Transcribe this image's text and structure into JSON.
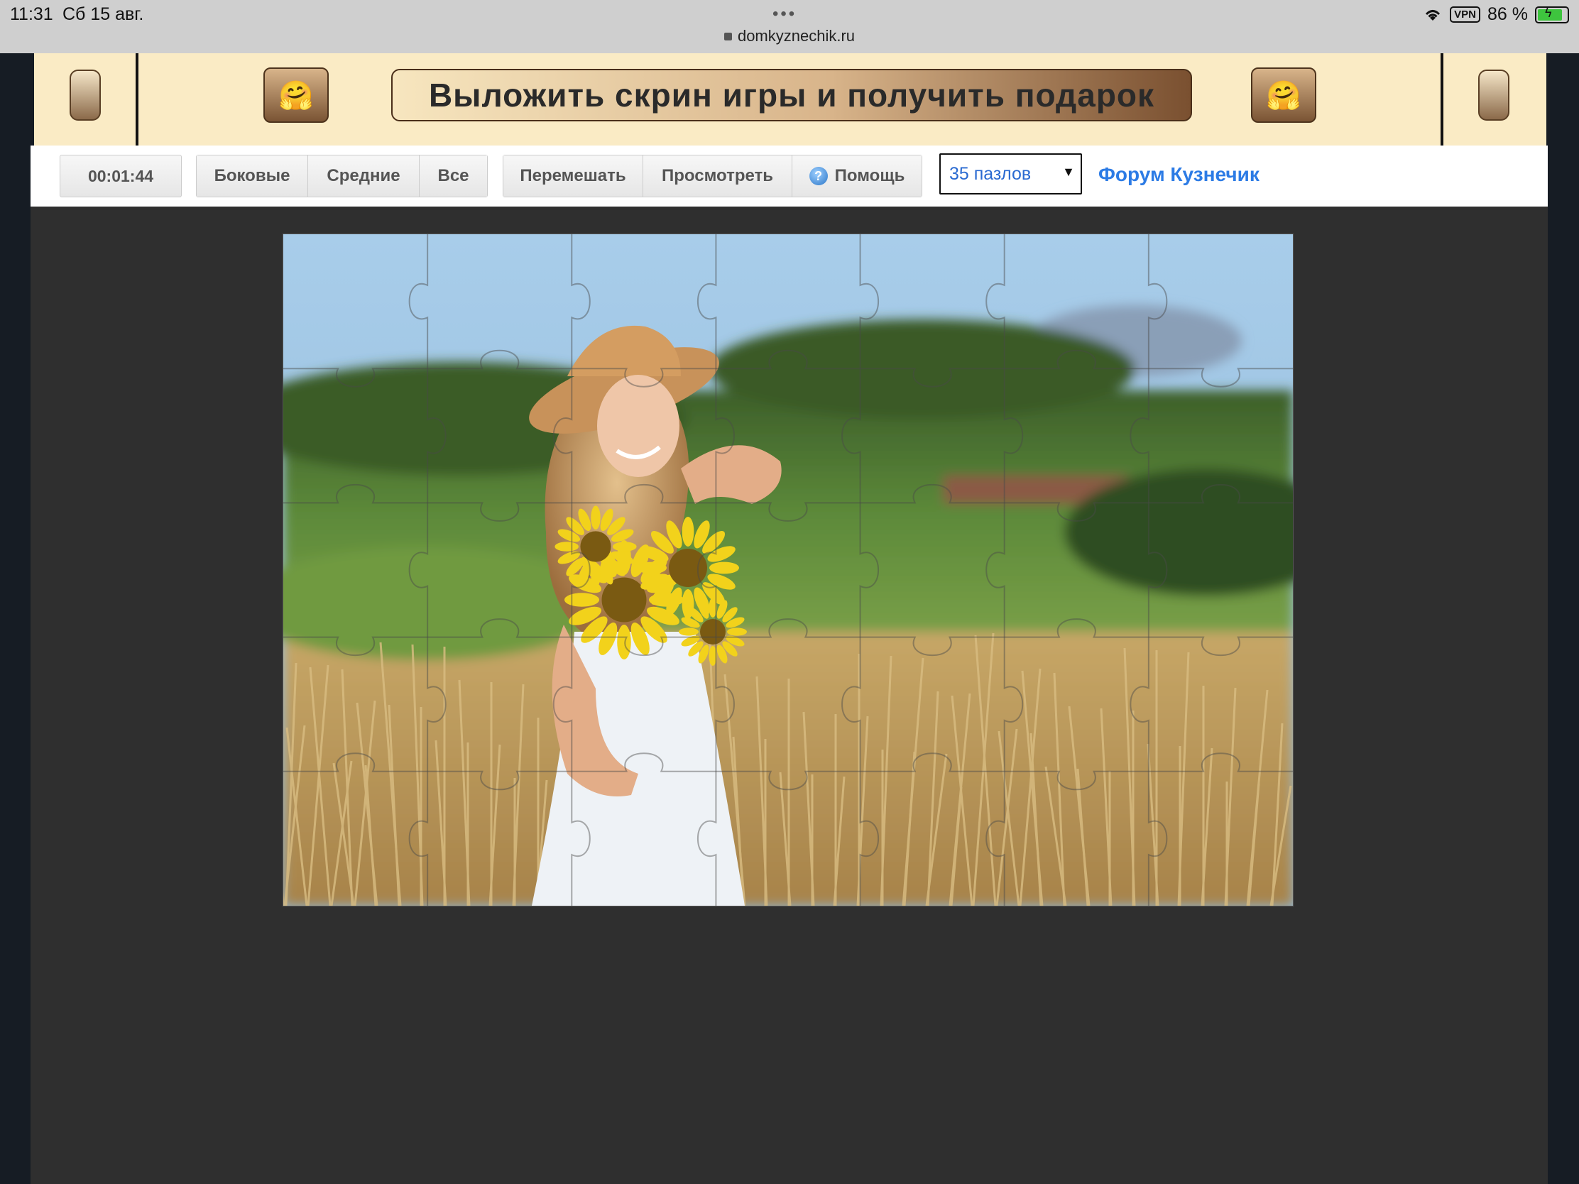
{
  "status_bar": {
    "time": "11:31",
    "date": "Сб 15 авг.",
    "url": "domkyznechik.ru",
    "vpn": "VPN",
    "battery": "86 %"
  },
  "banner": {
    "text": "Выложить скрин игры и получить подарок",
    "emoji_left": "🤗",
    "emoji_right": "🤗"
  },
  "toolbar": {
    "timer": "00:01:44",
    "filter_buttons": [
      "Боковые",
      "Средние",
      "Все"
    ],
    "action_buttons": [
      "Перемешать",
      "Просмотреть",
      "Помощь"
    ],
    "help_icon_glyph": "?",
    "piece_count_select": "35 пазлов",
    "forum_link": "Форум Кузнечик"
  },
  "puzzle": {
    "rows": 5,
    "cols": 7,
    "colors": {
      "sky": "#9cc3e4",
      "forest": "#3f6b2a",
      "field": "#c9a563",
      "sunflower": "#f2d21b"
    }
  }
}
